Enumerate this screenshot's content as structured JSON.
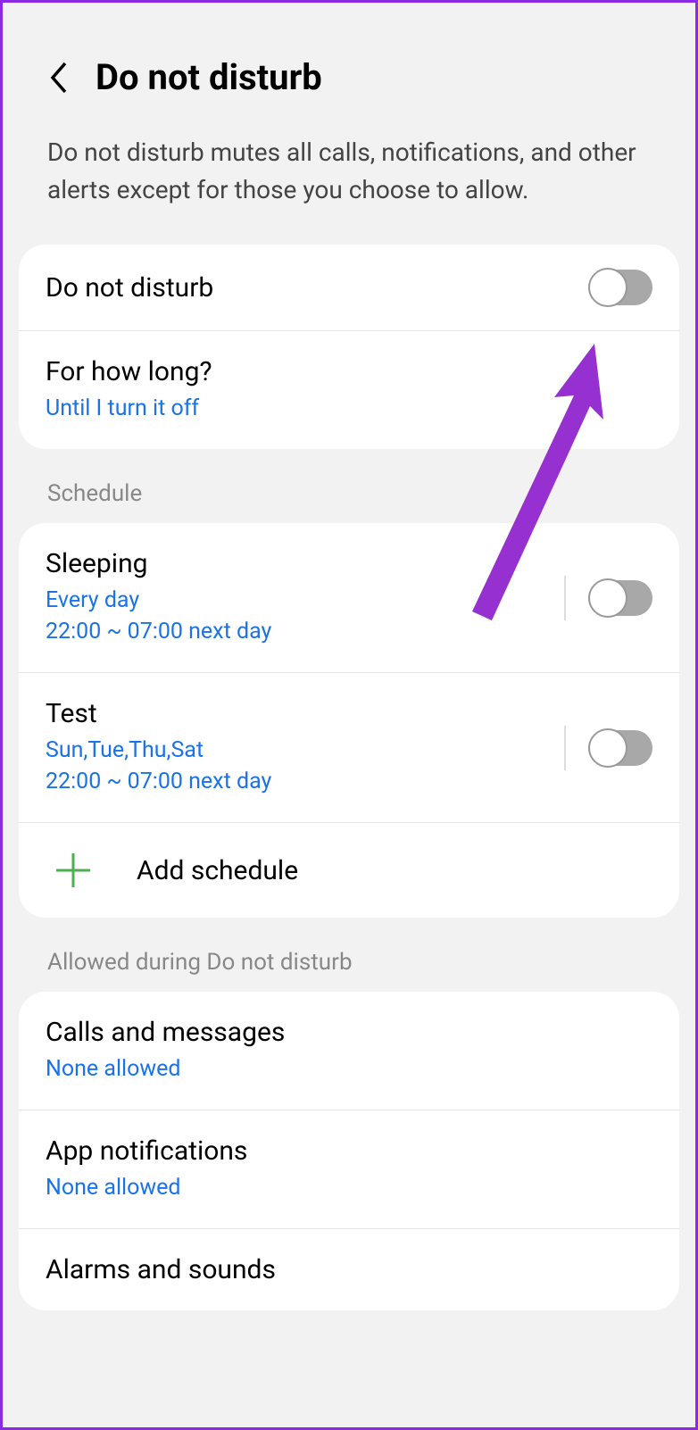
{
  "header": {
    "title": "Do not disturb"
  },
  "description": "Do not disturb mutes all calls, notifications, and other alerts except for those you choose to allow.",
  "main_toggle": {
    "label": "Do not disturb"
  },
  "duration": {
    "label": "For how long?",
    "value": "Until I turn it off"
  },
  "schedule_header": "Schedule",
  "schedules": [
    {
      "title": "Sleeping",
      "days": "Every day",
      "time": "22:00 ~ 07:00 next day"
    },
    {
      "title": "Test",
      "days": "Sun,Tue,Thu,Sat",
      "time": "22:00 ~ 07:00 next day"
    }
  ],
  "add_schedule": "Add schedule",
  "allowed_header": "Allowed during Do not disturb",
  "allowed": [
    {
      "title": "Calls and messages",
      "subtitle": "None allowed"
    },
    {
      "title": "App notifications",
      "subtitle": "None allowed"
    },
    {
      "title": "Alarms and sounds",
      "subtitle": ""
    }
  ]
}
